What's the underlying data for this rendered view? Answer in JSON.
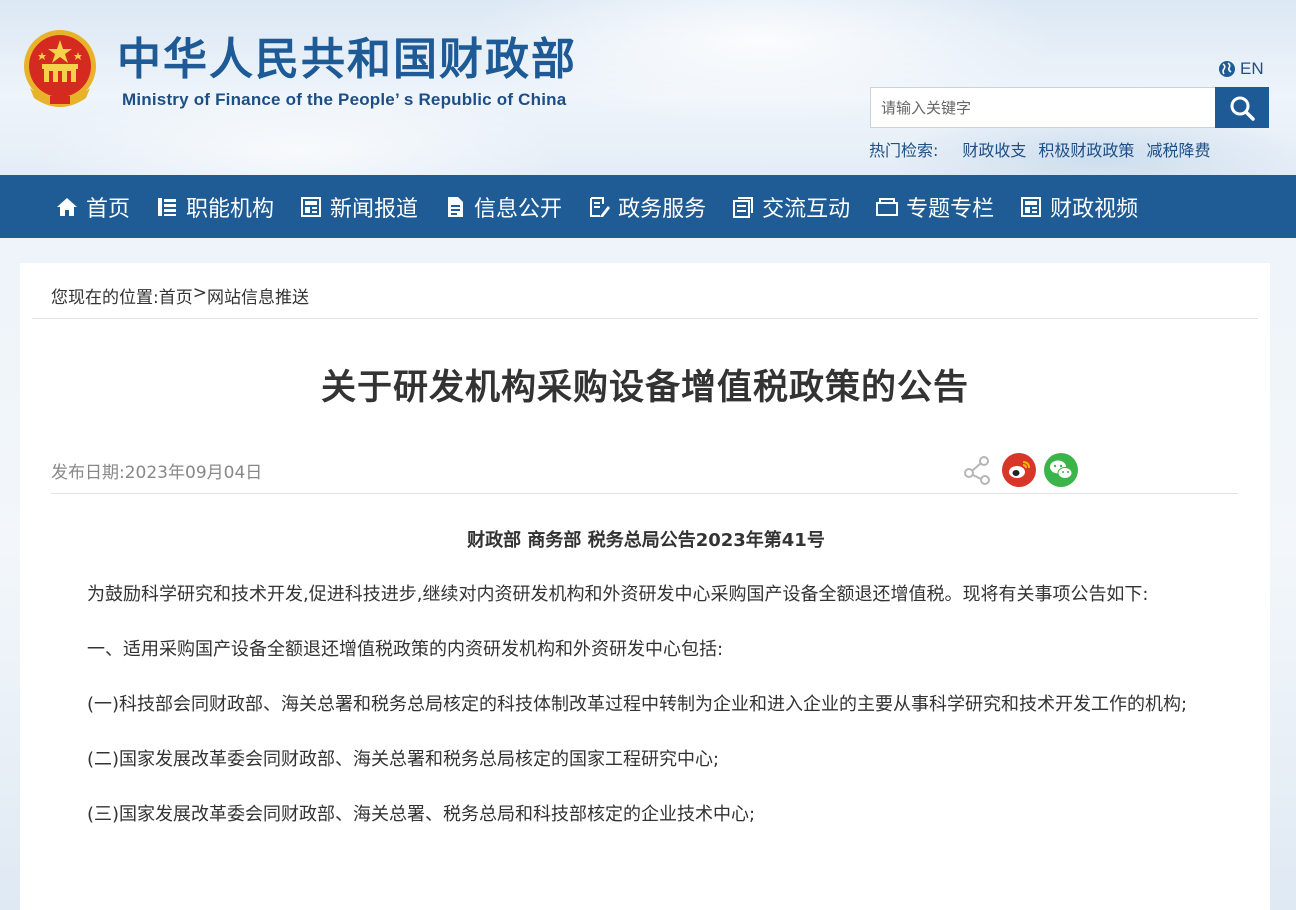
{
  "header": {
    "title_cn": "中华人民共和国财政部",
    "title_en": "Ministry of Finance of the People’ s Republic of China",
    "lang_switch": "EN",
    "search": {
      "placeholder": "请输入关键字",
      "value": ""
    },
    "hot_search": {
      "label": "热门检索:",
      "links": [
        "财政收支",
        "积极财政政策",
        "减税降费"
      ]
    }
  },
  "nav": {
    "items": [
      {
        "label": "首页",
        "icon": "home-icon"
      },
      {
        "label": "职能机构",
        "icon": "list-icon"
      },
      {
        "label": "新闻报道",
        "icon": "news-icon"
      },
      {
        "label": "信息公开",
        "icon": "document-icon"
      },
      {
        "label": "政务服务",
        "icon": "edit-document-icon"
      },
      {
        "label": "交流互动",
        "icon": "chat-icon"
      },
      {
        "label": "专题专栏",
        "icon": "folder-icon"
      },
      {
        "label": "财政视频",
        "icon": "video-icon"
      }
    ]
  },
  "breadcrumb": {
    "prefix": "您现在的位置:",
    "items": [
      "首页",
      "网站信息推送"
    ],
    "separator": ">"
  },
  "article": {
    "title": "关于研发机构采购设备增值税政策的公告",
    "date_label": "发布日期:",
    "date": "2023年09月04日",
    "doc_number": "财政部 商务部 税务总局公告2023年第41号",
    "paragraphs": [
      "为鼓励科学研究和技术开发,促进科技进步,继续对内资研发机构和外资研发中心采购国产设备全额退还增值税。现将有关事项公告如下:",
      "一、适用采购国产设备全额退还增值税政策的内资研发机构和外资研发中心包括:",
      "(一)科技部会同财政部、海关总署和税务总局核定的科技体制改革过程中转制为企业和进入企业的主要从事科学研究和技术开发工作的机构;",
      "(二)国家发展改革委会同财政部、海关总署和税务总局核定的国家工程研究中心;",
      "(三)国家发展改革委会同财政部、海关总署、税务总局和科技部核定的企业技术中心;"
    ]
  },
  "share": [
    "share-icon",
    "weibo-icon",
    "wechat-icon"
  ],
  "colors": {
    "brand_blue": "#1f5b95",
    "weibo_red": "#d9362a",
    "wechat_green": "#3bb54a"
  }
}
